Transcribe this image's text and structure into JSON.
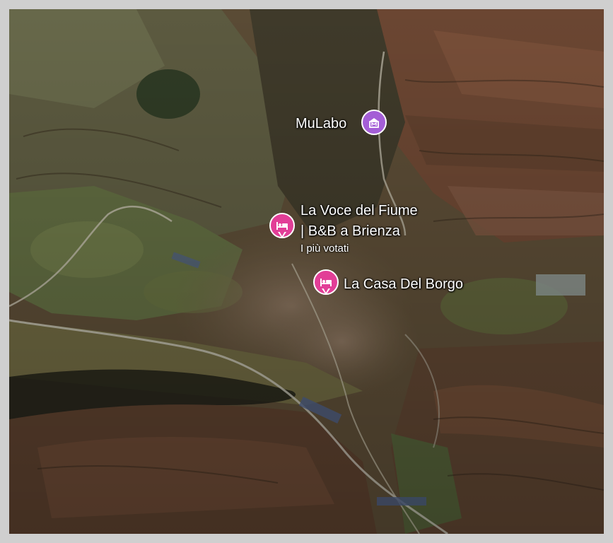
{
  "map": {
    "view": "satellite 3D",
    "places": [
      {
        "id": "mulabo",
        "name_lines": [
          "MuLabo"
        ],
        "subtitle": "",
        "icon": "museum-icon",
        "color": "#a45ed6"
      },
      {
        "id": "la-voce-del-fiume",
        "name_lines": [
          "La Voce del Fiume",
          "| B&B a Brienza"
        ],
        "subtitle": "I più votati",
        "icon": "bed-icon",
        "color": "#e23e97"
      },
      {
        "id": "la-casa-del-borgo",
        "name_lines": [
          "La Casa Del Borgo"
        ],
        "subtitle": "",
        "icon": "bed-icon",
        "color": "#e23e97"
      }
    ]
  }
}
